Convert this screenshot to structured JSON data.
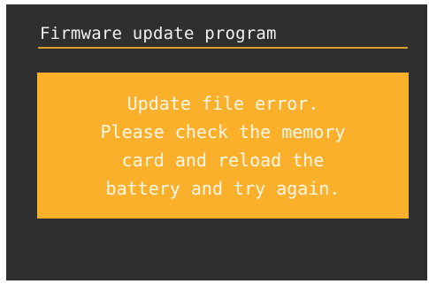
{
  "dialog": {
    "title": "Firmware update program",
    "message_lines": [
      "Update file error.",
      "Please check the memory",
      "card and reload the",
      "battery and try again."
    ]
  },
  "colors": {
    "screen_bg": "#2f2f2f",
    "accent": "#fbb02b",
    "rule": "#d9a12a",
    "text": "#f2f2f2"
  }
}
